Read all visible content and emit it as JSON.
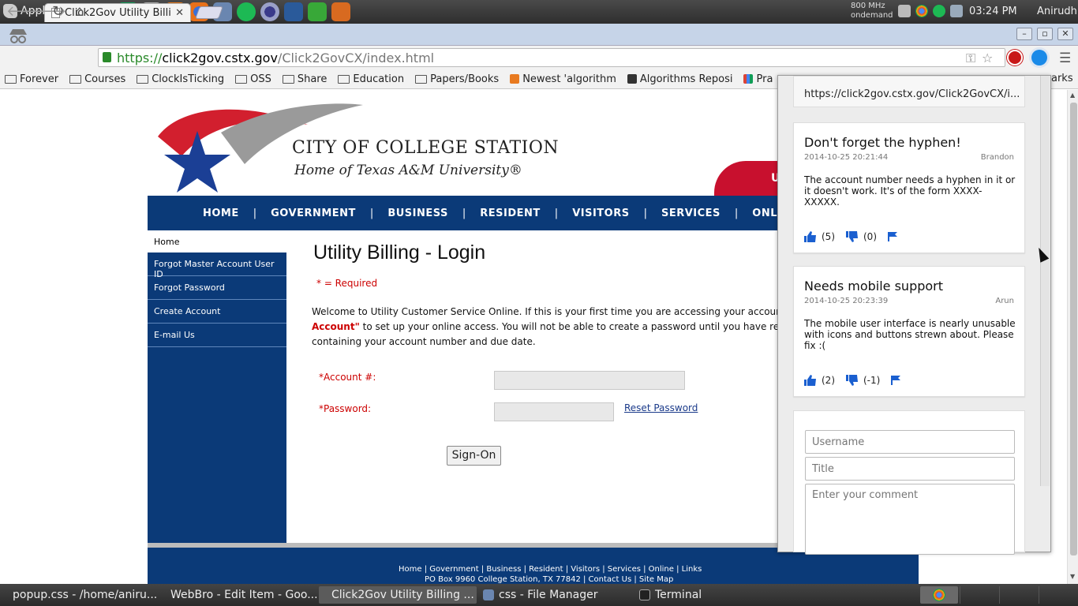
{
  "os_panel": {
    "applications_menu": "Applications Menu",
    "cpu_freq": "800 MHz",
    "cpu_governor": "ondemand",
    "clock": "03:24 PM",
    "user": "Anirudh"
  },
  "browser": {
    "tab_title": "Click2Gov Utility Billi",
    "url_https": "https://",
    "url_domain": "click2gov.cstx.gov",
    "url_path": "/Click2GovCX/index.html",
    "bookmarks": [
      "Forever",
      "Courses",
      "ClockIsTicking",
      "OSS",
      "Share",
      "Education",
      "Papers/Books",
      "Newest 'algorithm",
      "Algorithms Reposi",
      "Pra"
    ],
    "bookmarks_tail": "arks"
  },
  "site": {
    "name": "City of College Station",
    "tagline": "Home of Texas A&M University®",
    "banner_letter": "U",
    "nav": [
      "HOME",
      "GOVERNMENT",
      "BUSINESS",
      "RESIDENT",
      "VISITORS",
      "SERVICES",
      "ONLINE"
    ],
    "nav_sep": "|",
    "sidebar_home": "Home",
    "sidebar": [
      "Forgot Master Account User ID",
      "Forgot Password",
      "Create Account",
      "E-mail Us"
    ],
    "title": "Utility Billing - Login",
    "required_note": "* = Required",
    "welcome_part1": "Welcome to Utility Customer Service Online. If this is your first time you are accessing your account, plea",
    "welcome_bold": "Account\"",
    "welcome_part2": " to set up your online access. You will not be able to create a password until you have received",
    "welcome_part3": "containing your account number and due date.",
    "account_label": "*Account #:",
    "password_label": "*Password:",
    "reset_link": "Reset Password ",
    "signon": "Sign-On",
    "footer_links": "Home | Government | Business | Resident | Visitors | Services | Online | Links",
    "footer_address": "PO Box 9960 College Station, TX 77842 | Contact Us | Site Map"
  },
  "popup": {
    "url": "https://click2gov.cstx.gov/Click2GovCX/i...",
    "comments": [
      {
        "title": "Don't forget the hyphen!",
        "date": "2014-10-25 20:21:44",
        "author": "Brandon",
        "body": "The account number needs a hyphen in it or it doesn't work. It's of the form XXXX-XXXXX.",
        "up": "(5)",
        "down": "(0)"
      },
      {
        "title": "Needs mobile support",
        "date": "2014-10-25 20:23:39",
        "author": "Arun",
        "body": "The mobile user interface is nearly unusable with icons and buttons strewn about. Please fix :(",
        "up": "(2)",
        "down": "(-1)"
      }
    ],
    "username_placeholder": "Username",
    "title_placeholder": "Title",
    "comment_placeholder": "Enter your comment"
  },
  "taskbar": [
    "popup.css - /home/aniru...",
    "WebBro - Edit Item - Goo...",
    "Click2Gov Utility Billing ...",
    "css - File Manager",
    "Terminal"
  ],
  "colors": {
    "site_blue": "#0b3a78",
    "required_red": "#c00000",
    "vote_blue": "#1a5fd0"
  }
}
